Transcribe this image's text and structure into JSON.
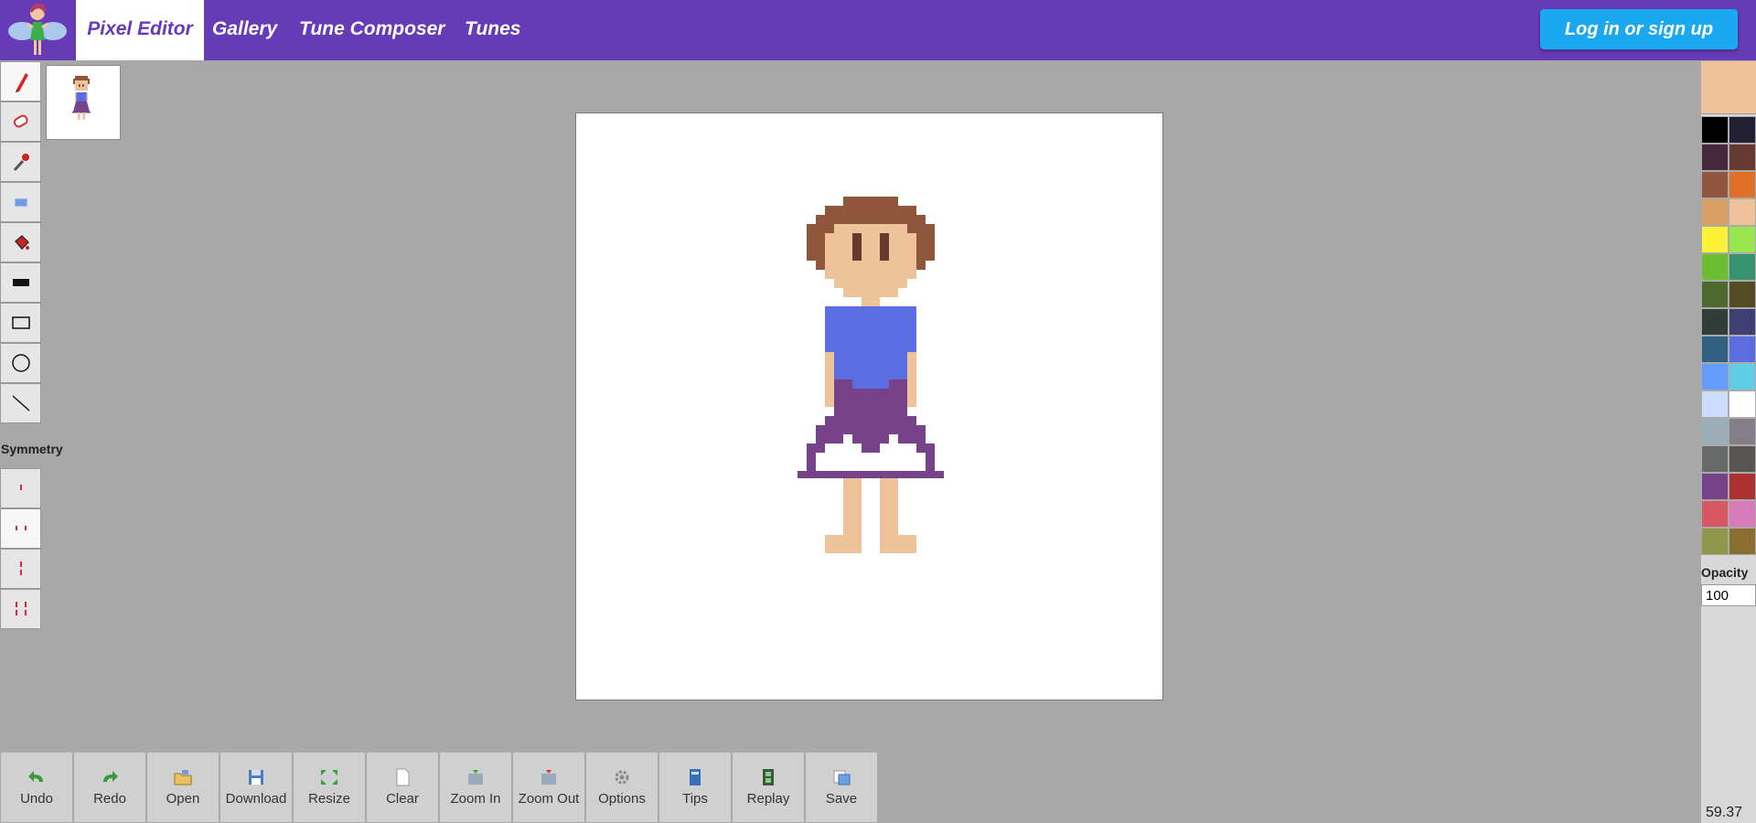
{
  "nav": {
    "items": [
      "Pixel Editor",
      "Gallery",
      "Tune Composer",
      "Tunes"
    ],
    "login": "Log in or sign up"
  },
  "tools": [
    {
      "name": "pencil-tool",
      "icon": "pencil-icon"
    },
    {
      "name": "eraser-tool",
      "icon": "eraser-icon"
    },
    {
      "name": "eyedropper-tool",
      "icon": "eyedropper-icon"
    },
    {
      "name": "select-tool",
      "icon": "selection-icon"
    },
    {
      "name": "fill-tool",
      "icon": "paint-bucket-icon"
    },
    {
      "name": "filled-rectangle-tool",
      "icon": "filled-rectangle-icon"
    },
    {
      "name": "rectangle-tool",
      "icon": "rectangle-outline-icon"
    },
    {
      "name": "ellipse-tool",
      "icon": "circle-outline-icon"
    },
    {
      "name": "line-tool",
      "icon": "line-icon"
    }
  ],
  "symmetry": {
    "label": "Symmetry",
    "modes": [
      "none",
      "horizontal",
      "vertical",
      "both"
    ]
  },
  "palette": {
    "current": "#efc29a",
    "colors": [
      "#000000",
      "#222034",
      "#45283c",
      "#663931",
      "#8f563b",
      "#df7126",
      "#d9a066",
      "#eec39a",
      "#fbf236",
      "#99e550",
      "#6abe30",
      "#37946e",
      "#4b692f",
      "#524b24",
      "#323c39",
      "#3f3f74",
      "#306082",
      "#5b6ee1",
      "#639bff",
      "#5fcde4",
      "#cbdbfc",
      "#ffffff",
      "#9badb7",
      "#847e87",
      "#696a6a",
      "#595652",
      "#76428a",
      "#ac3232",
      "#d95763",
      "#d77bba",
      "#8f974a",
      "#8a6f30"
    ],
    "opacity_label": "Opacity",
    "opacity_value": "100"
  },
  "fps": "59.37",
  "bottom": [
    {
      "name": "undo-button",
      "label": "Undo",
      "icon": "undo-icon"
    },
    {
      "name": "redo-button",
      "label": "Redo",
      "icon": "redo-icon"
    },
    {
      "name": "open-button",
      "label": "Open",
      "icon": "folder-icon"
    },
    {
      "name": "download-button",
      "label": "Download",
      "icon": "floppy-icon"
    },
    {
      "name": "resize-button",
      "label": "Resize",
      "icon": "resize-icon"
    },
    {
      "name": "clear-button",
      "label": "Clear",
      "icon": "page-icon"
    },
    {
      "name": "zoom-in-button",
      "label": "Zoom In",
      "icon": "zoom-in-icon"
    },
    {
      "name": "zoom-out-button",
      "label": "Zoom Out",
      "icon": "zoom-out-icon"
    },
    {
      "name": "options-button",
      "label": "Options",
      "icon": "gear-icon"
    },
    {
      "name": "tips-button",
      "label": "Tips",
      "icon": "book-icon"
    },
    {
      "name": "replay-button",
      "label": "Replay",
      "icon": "film-icon"
    },
    {
      "name": "save-button",
      "label": "Save",
      "icon": "save-icon"
    }
  ]
}
